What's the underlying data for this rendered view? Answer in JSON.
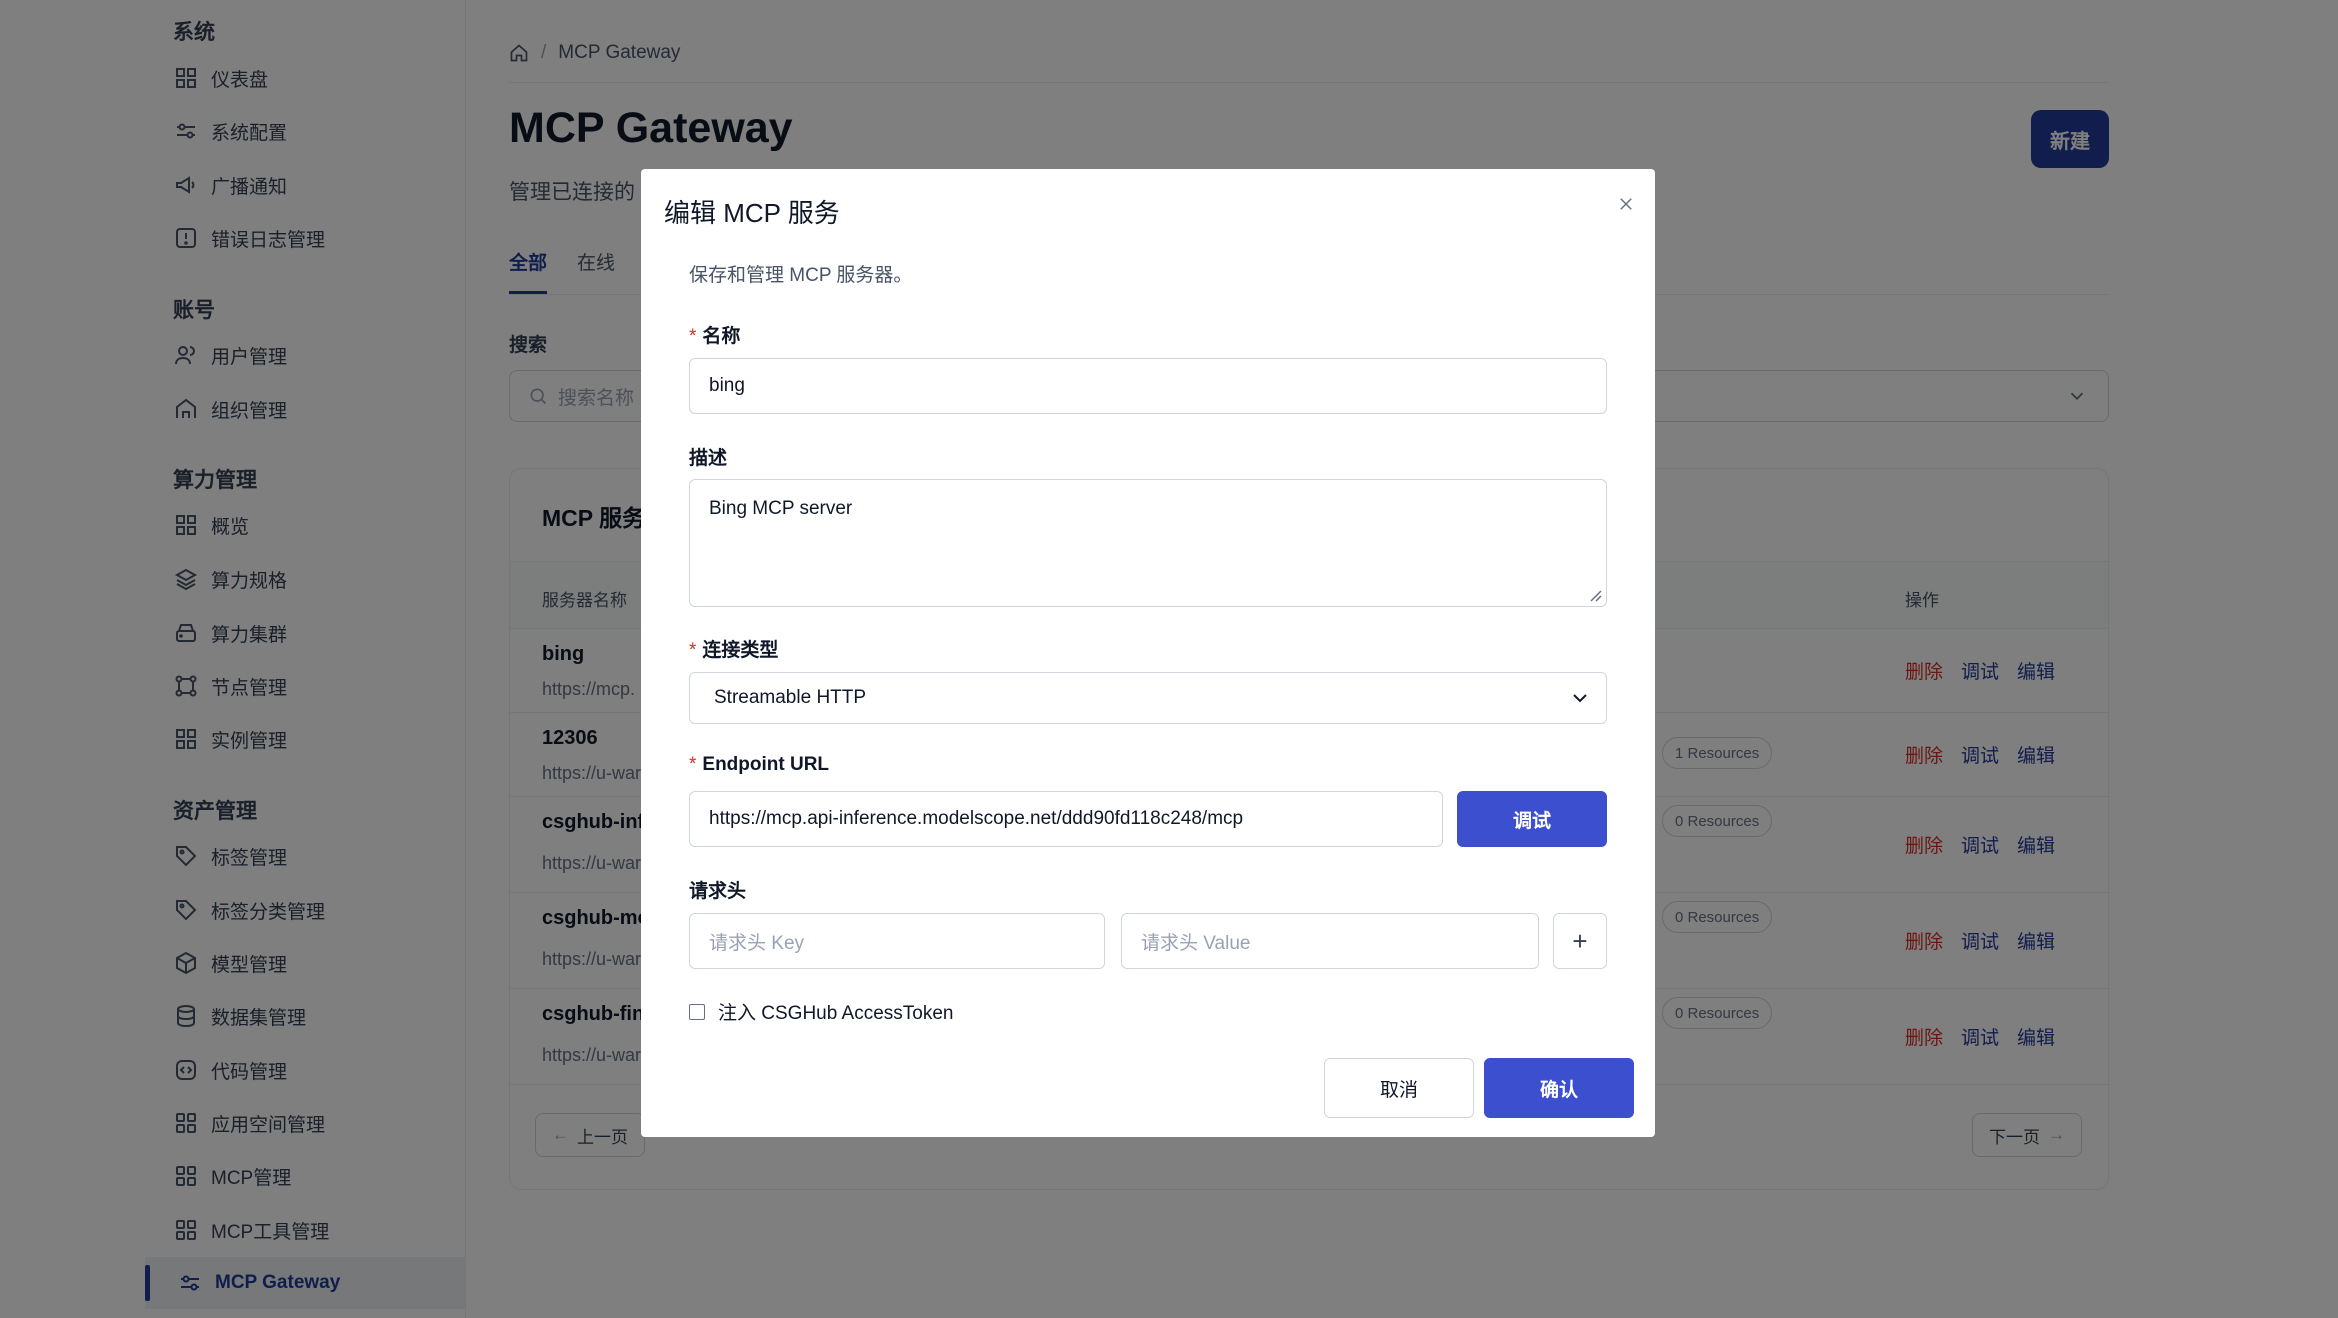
{
  "sidebar": {
    "groups": [
      {
        "title": "系统",
        "items": [
          {
            "label": "仪表盘",
            "icon": "dashboard-icon"
          },
          {
            "label": "系统配置",
            "icon": "sliders-icon"
          },
          {
            "label": "广播通知",
            "icon": "megaphone-icon"
          },
          {
            "label": "错误日志管理",
            "icon": "alert-icon"
          }
        ]
      },
      {
        "title": "账号",
        "items": [
          {
            "label": "用户管理",
            "icon": "users-icon"
          },
          {
            "label": "组织管理",
            "icon": "organization-icon"
          }
        ]
      },
      {
        "title": "算力管理",
        "items": [
          {
            "label": "概览",
            "icon": "grid-icon"
          },
          {
            "label": "算力规格",
            "icon": "layers-icon"
          },
          {
            "label": "算力集群",
            "icon": "server-icon"
          },
          {
            "label": "节点管理",
            "icon": "nodes-icon"
          },
          {
            "label": "实例管理",
            "icon": "grid-icon"
          }
        ]
      },
      {
        "title": "资产管理",
        "items": [
          {
            "label": "标签管理",
            "icon": "tag-icon"
          },
          {
            "label": "标签分类管理",
            "icon": "tag-icon"
          },
          {
            "label": "模型管理",
            "icon": "cube-icon"
          },
          {
            "label": "数据集管理",
            "icon": "database-icon"
          },
          {
            "label": "代码管理",
            "icon": "code-icon"
          },
          {
            "label": "应用空间管理",
            "icon": "grid-icon"
          },
          {
            "label": "MCP管理",
            "icon": "grid-icon"
          },
          {
            "label": "MCP工具管理",
            "icon": "grid-icon"
          },
          {
            "label": "MCP Gateway",
            "icon": "sliders-icon",
            "active": true
          }
        ]
      }
    ]
  },
  "main": {
    "breadcrumb": {
      "home_icon": "home-icon",
      "current": "MCP Gateway"
    },
    "title": "MCP Gateway",
    "subtitle": "管理已连接的",
    "new_button": "新建",
    "tabs": [
      "全部",
      "在线"
    ],
    "search_label": "搜索",
    "search_placeholder": "搜索名称",
    "card_title": "MCP 服务",
    "table_headers": {
      "name": "服务器名称",
      "actions": "操作"
    },
    "rows": [
      {
        "name": "bing",
        "url": "https://mcp.",
        "resources": ""
      },
      {
        "name": "12306",
        "url": "https://u-war",
        "resources": "1 Resources"
      },
      {
        "name": "csghub-infe",
        "url": "https://u-war",
        "resources": "0 Resources"
      },
      {
        "name": "csghub-mo",
        "url": "https://u-war",
        "resources": "0 Resources"
      },
      {
        "name": "csghub-fine",
        "url": "https://u-war",
        "resources": "0 Resources"
      }
    ],
    "row_actions": {
      "delete": "删除",
      "debug": "调试",
      "edit": "编辑"
    },
    "pager": {
      "prev": "上一页",
      "next": "下一页"
    }
  },
  "modal": {
    "title": "编辑 MCP 服务",
    "description": "保存和管理 MCP 服务器。",
    "name_label": "名称",
    "name_value": "bing",
    "desc_label": "描述",
    "desc_value": "Bing MCP server",
    "conn_label": "连接类型",
    "conn_value": "Streamable HTTP",
    "endpoint_label": "Endpoint URL",
    "endpoint_value": "https://mcp.api-inference.modelscope.net/ddd90fd118c248/mcp",
    "debug_button": "调试",
    "headers_label": "请求头",
    "header_key_placeholder": "请求头 Key",
    "header_value_placeholder": "请求头 Value",
    "add_header": "+",
    "inject_token_label": "注入 CSGHub AccessToken",
    "cancel_button": "取消",
    "confirm_button": "确认",
    "required_mark": "*"
  },
  "colors": {
    "primary": "#223b99",
    "button": "#3b4fcf",
    "danger": "#d92d20",
    "overlay": "rgba(0,0,0,0.5)"
  }
}
